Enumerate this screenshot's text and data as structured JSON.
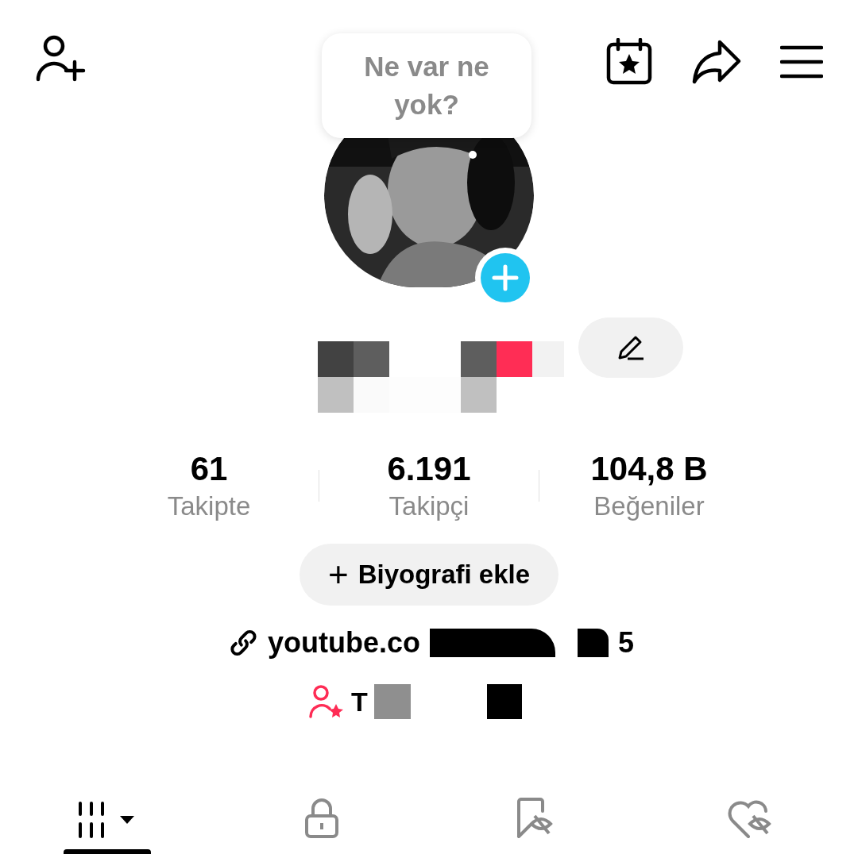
{
  "story_bubble": {
    "text": "Ne var ne yok?"
  },
  "stats": [
    {
      "value": "61",
      "label": "Takipte"
    },
    {
      "value": "6.191",
      "label": "Takipçi"
    },
    {
      "value": "104,8 B",
      "label": "Beğeniler"
    }
  ],
  "bio_button": {
    "icon": "+",
    "label": "Biyografi ekle"
  },
  "link": {
    "text": "youtube.co",
    "tail": "5"
  },
  "friends_line": {
    "text": "T"
  },
  "tabs": [
    {
      "kind": "videos",
      "selected": true
    },
    {
      "kind": "private",
      "selected": false
    },
    {
      "kind": "saved",
      "selected": false
    },
    {
      "kind": "liked",
      "selected": false
    }
  ]
}
